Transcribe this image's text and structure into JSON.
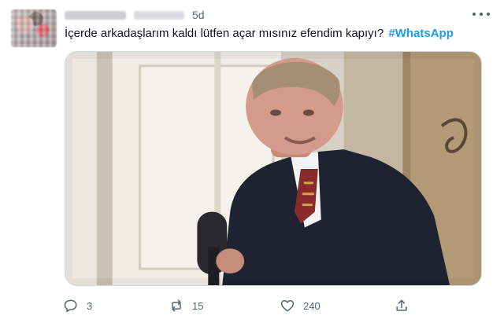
{
  "tweet": {
    "time": "5d",
    "text": "İçerde arkadaşlarım kaldı lütfen açar mısınız efendim kapıyı?",
    "hashtag": "#WhatsApp"
  },
  "actions": {
    "reply_count": "3",
    "retweet_count": "15",
    "like_count": "240"
  },
  "colors": {
    "accent": "#1d9bf0",
    "muted": "#536471",
    "text": "#0f1419",
    "border": "#cfd9de"
  },
  "icons": {
    "more": "more-dots-icon",
    "reply": "reply-bubble-icon",
    "retweet": "retweet-icon",
    "like": "heart-icon",
    "share": "share-icon"
  }
}
